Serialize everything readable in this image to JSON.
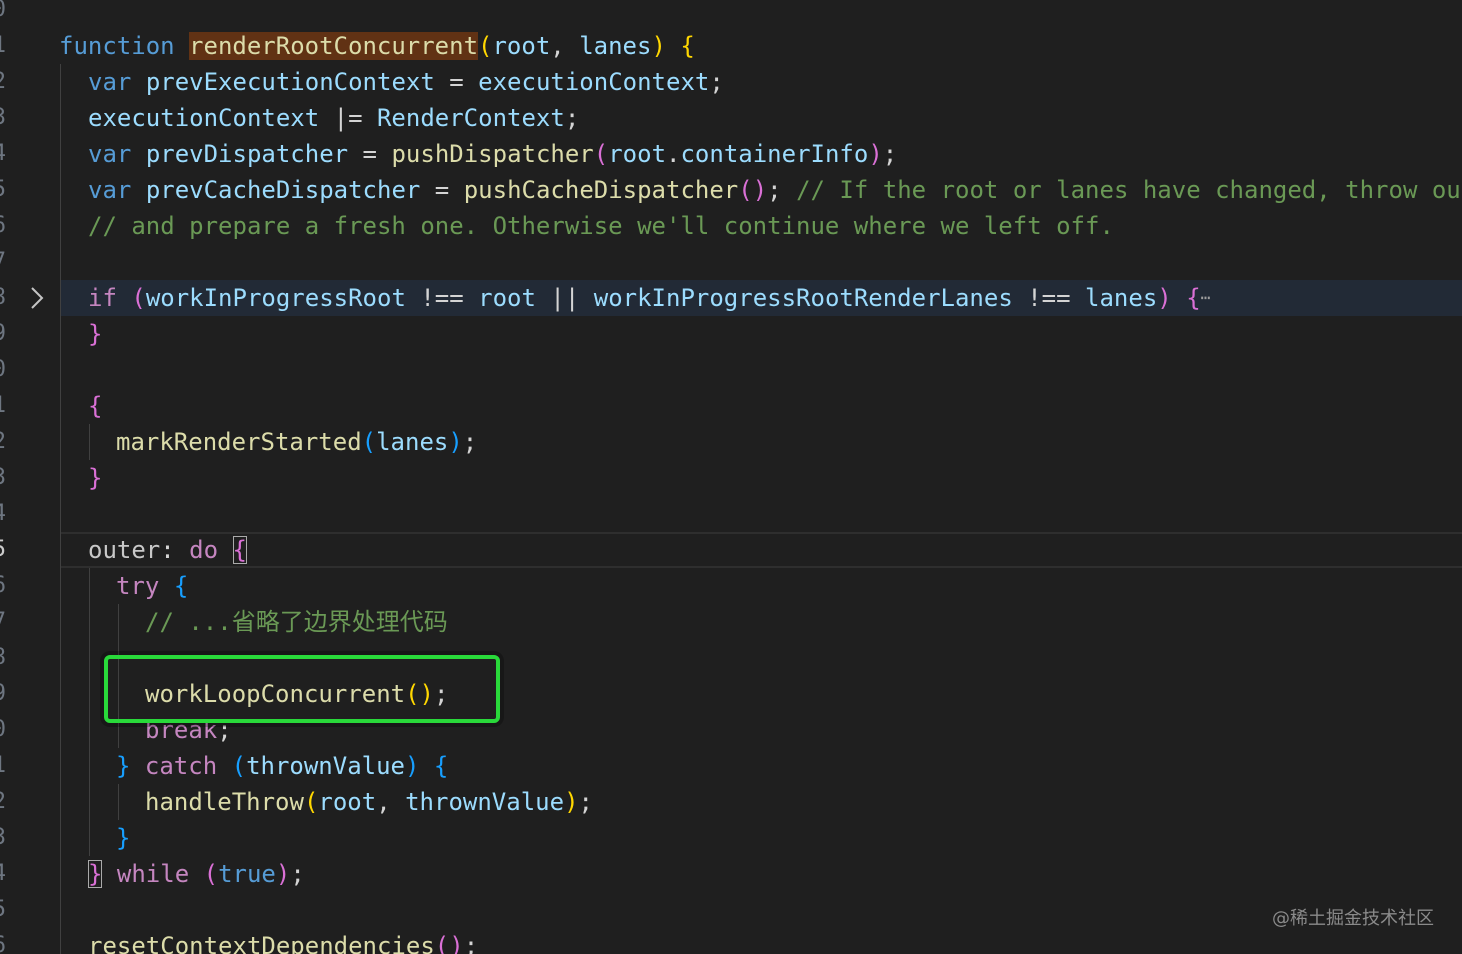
{
  "editor": {
    "line_numbers": [
      "0",
      "1",
      "2",
      "3",
      "4",
      "5",
      "6",
      "7",
      "8",
      "9",
      "0",
      "1",
      "2",
      "3",
      "4",
      "5",
      "6",
      "7",
      "8",
      "9",
      "0",
      "1",
      "2",
      "3",
      "4",
      "5",
      "6"
    ],
    "active_line_index": 15,
    "watermark": "@稀土掘金技术社区"
  },
  "code": {
    "l1": {
      "kw": "function",
      "fn": "renderRootConcurrent",
      "p_open": "(",
      "a1": "root",
      "comma": ", ",
      "a2": "lanes",
      "p_close": ")",
      "brace": "{"
    },
    "l2": {
      "kw": "var",
      "name": "prevExecutionContext",
      "eq": " = ",
      "val": "executionContext",
      "semi": ";"
    },
    "l3": {
      "name": "executionContext",
      "op": " |= ",
      "cls": "RenderContext",
      "semi": ";"
    },
    "l4": {
      "kw": "var",
      "name": "prevDispatcher",
      "eq": " = ",
      "fn": "pushDispatcher",
      "p_open": "(",
      "obj": "root",
      "dot": ".",
      "prop": "containerInfo",
      "p_close": ")",
      "semi": ";"
    },
    "l5": {
      "kw": "var",
      "name": "prevCacheDispatcher",
      "eq": " = ",
      "fn": "pushCacheDispatcher",
      "parens": "()",
      "semi": ";",
      "comment": " // If the root or lanes have changed, throw out the existing stack"
    },
    "l6": {
      "comment": "// and prepare a fresh one. Otherwise we'll continue where we left off."
    },
    "l8": {
      "kw": "if",
      "p_open": "(",
      "v1": "workInProgressRoot",
      "op1": " !== ",
      "v2": "root",
      "op2": " || ",
      "v3": "workInProgressRootRenderLanes",
      "op3": " !== ",
      "v4": "lanes",
      "p_close": ")",
      "brace": "{",
      "dots": "⋯"
    },
    "l9": {
      "brace": "}"
    },
    "l11": {
      "brace": "{"
    },
    "l12": {
      "fn": "markRenderStarted",
      "p_open": "(",
      "arg": "lanes",
      "p_close": ")",
      "semi": ";"
    },
    "l13": {
      "brace": "}"
    },
    "l15": {
      "label": "outer",
      "colon": ": ",
      "kw": "do",
      "brace": "{"
    },
    "l16": {
      "kw": "try",
      "brace": "{"
    },
    "l17": {
      "comment": "// ...省略了边界处理代码"
    },
    "l19": {
      "fn": "workLoopConcurrent",
      "parens": "()",
      "semi": ";"
    },
    "l20": {
      "kw": "break",
      "semi": ";"
    },
    "l21": {
      "brace_close": "}",
      "kw": "catch",
      "p_open": "(",
      "param": "thrownValue",
      "p_close": ")",
      "brace": "{"
    },
    "l22": {
      "fn": "handleThrow",
      "p_open": "(",
      "a1": "root",
      "comma": ", ",
      "a2": "thrownValue",
      "p_close": ")",
      "semi": ";"
    },
    "l23": {
      "brace": "}"
    },
    "l24": {
      "brace": "}",
      "kw": "while",
      "p_open": "(",
      "val": "true",
      "p_close": ")",
      "semi": ";"
    },
    "l26": {
      "fn": "resetContextDependencies",
      "parens": "()",
      "semi": ";"
    }
  },
  "colors": {
    "background": "#1f1f1f",
    "keyword": "#569cd6",
    "control": "#c586c0",
    "function": "#dcdcaa",
    "variable": "#9cdcfe",
    "comment": "#6a9955",
    "annotation_box": "#29d93a"
  },
  "icons": {
    "fold": "chevron-right-icon"
  }
}
